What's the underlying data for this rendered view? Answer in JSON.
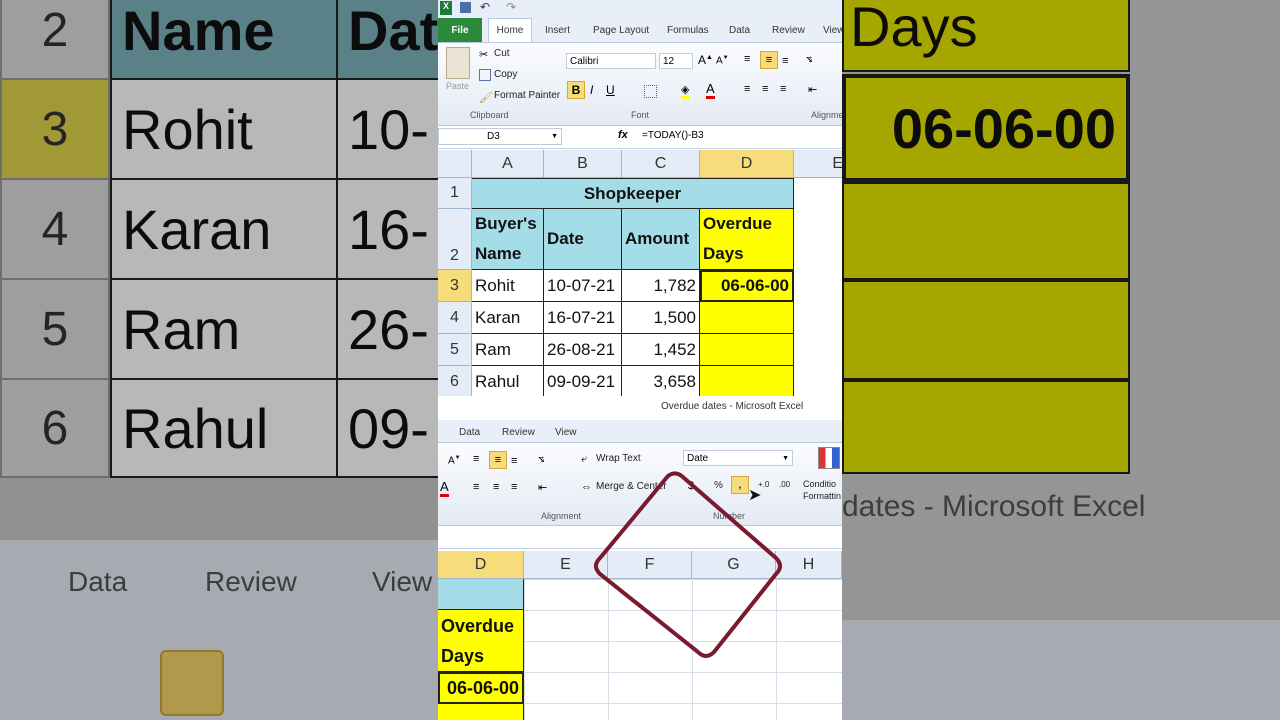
{
  "background": {
    "left": {
      "row_headers": [
        "2",
        "3",
        "4",
        "5",
        "6"
      ],
      "name_cells": [
        "Name",
        "Rohit",
        "Karan",
        "Ram",
        "Rahul"
      ],
      "date_cells": [
        "Date",
        "10-",
        "16-",
        "26-",
        "09-"
      ],
      "ribbon_tabs": [
        "Data",
        "Review",
        "View"
      ]
    },
    "right": {
      "header_text": "Days",
      "value_text": "06-06-00",
      "title_text": "dates  -  Microsoft Excel"
    }
  },
  "excel": {
    "tabs": [
      "File",
      "Home",
      "Insert",
      "Page Layout",
      "Formulas",
      "Data",
      "Review",
      "View"
    ],
    "clipboard": {
      "cut": "Cut",
      "copy": "Copy",
      "format_painter": "Format Painter",
      "paste": "Paste",
      "group": "Clipboard"
    },
    "font": {
      "name": "Calibri",
      "size": "12",
      "group": "Font"
    },
    "alignment_group": "Alignment",
    "name_box": "D3",
    "fx": "fx",
    "formula": "=TODAY()-B3",
    "columns": [
      "A",
      "B",
      "C",
      "D",
      "E"
    ],
    "rows": [
      "1",
      "2",
      "3",
      "4",
      "5",
      "6"
    ],
    "title": "Shopkeeper",
    "headers": {
      "name": "Buyer's Name",
      "date": "Date",
      "amount": "Amount",
      "overdue": "Overdue Days"
    },
    "data_rows": [
      {
        "name": "Rohit",
        "date": "10-07-21",
        "amount": "1,782",
        "overdue": "06-06-00"
      },
      {
        "name": "Karan",
        "date": "16-07-21",
        "amount": "1,500",
        "overdue": ""
      },
      {
        "name": "Ram",
        "date": "26-08-21",
        "amount": "1,452",
        "overdue": ""
      },
      {
        "name": "Rahul",
        "date": "09-09-21",
        "amount": "3,658",
        "overdue": ""
      }
    ],
    "window_title": "Overdue dates  -  Microsoft Excel",
    "lower": {
      "tabs": [
        "Data",
        "Review",
        "View"
      ],
      "wrap_text": "Wrap Text",
      "merge_center": "Merge & Center",
      "number_format": "Date",
      "percent": "%",
      "comma": ",",
      "dec_inc": "+.0",
      "dec_dec": ".00",
      "alignment_group": "Alignment",
      "number_group": "Number",
      "conditional": "Conditio Formattin",
      "columns": [
        "D",
        "E",
        "F",
        "G",
        "H"
      ],
      "overdue_header": "Overdue Days",
      "overdue_value": "06-06-00"
    }
  },
  "colors": {
    "cyan": "#a4dde8",
    "yellow": "#ffff00",
    "annotation": "#7a1a2e",
    "file_tab": "#2a8a3a"
  }
}
